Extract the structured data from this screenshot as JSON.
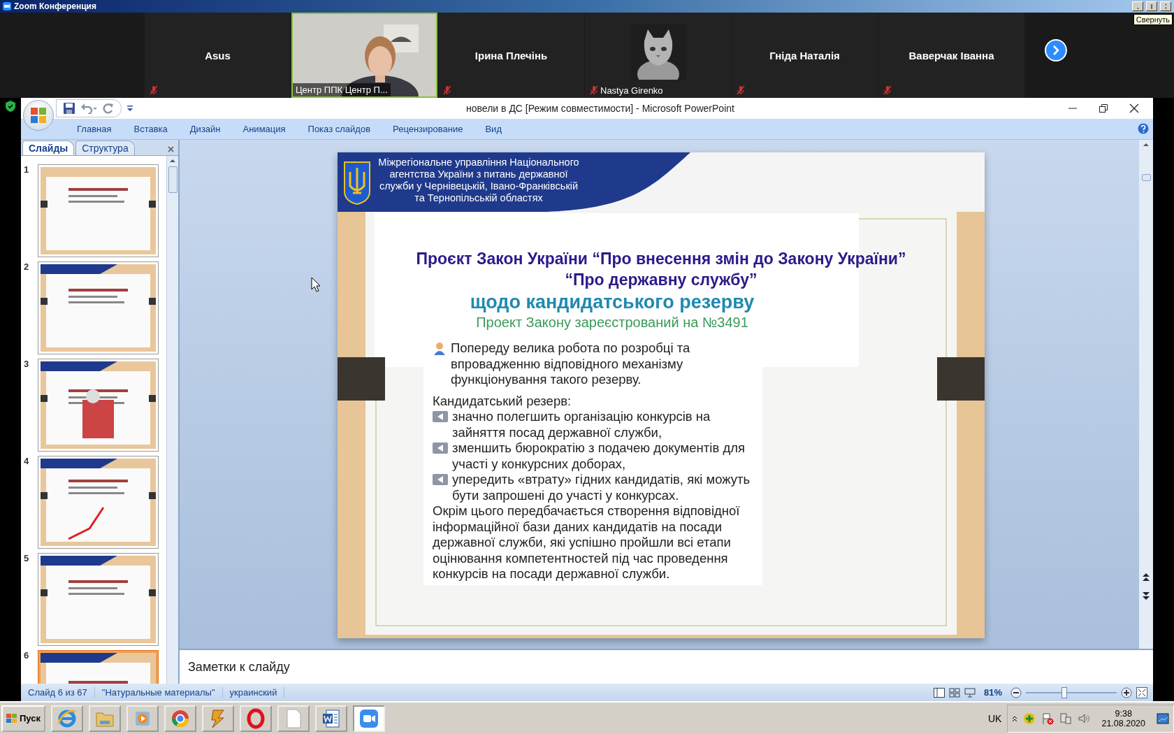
{
  "zoom_window": {
    "title": "Zoom Конференция",
    "tooltip": "Свернуть"
  },
  "participants": [
    {
      "name": "Asus",
      "kind": "name",
      "selected": false
    },
    {
      "name": "Центр ППК Центр П...",
      "kind": "video",
      "selected": true
    },
    {
      "name": "Ірина Плечінь",
      "kind": "name",
      "selected": false
    },
    {
      "name": "Nastya Girenko",
      "selected": false
    },
    {
      "name": "Гніда Наталія",
      "kind": "name",
      "selected": false
    },
    {
      "name": "Ваверчак Іванна",
      "kind": "name",
      "selected": false
    }
  ],
  "powerpoint": {
    "title": "новели в ДС [Режим совместимости] - Microsoft PowerPoint",
    "ribbon_tabs": [
      "Главная",
      "Вставка",
      "Дизайн",
      "Анимация",
      "Показ слайдов",
      "Рецензирование",
      "Вид"
    ],
    "pane_tabs": [
      {
        "label": "Слайды",
        "selected": true
      },
      {
        "label": "Структура",
        "selected": false
      }
    ],
    "thumbnails": [
      {
        "number": "1",
        "selected": false
      },
      {
        "number": "2",
        "selected": false
      },
      {
        "number": "3",
        "selected": false
      },
      {
        "number": "4",
        "selected": false
      },
      {
        "number": "5",
        "selected": false
      },
      {
        "number": "6",
        "selected": true
      }
    ],
    "slide": {
      "header_lines": [
        "Міжрегіональне управління Національного",
        "агентства України з питань державної",
        "служби  у Чернівецькій, Івано-Франківській",
        "та Тернопільській областях"
      ],
      "title_lines": [
        "Проєкт Закон України “Про внесення змін до Закону України”",
        "“Про державну службу”"
      ],
      "subtitle": "щодо  кандидатського резерву",
      "note": "Проект Закону зареєстрований на №3491",
      "body": [
        {
          "kind": "person",
          "text": "Попереду велика робота по розробці та впровадженню відповідного механізму функціонування такого резерву."
        },
        {
          "kind": "gap",
          "text": "Кандидатський резерв:"
        },
        {
          "kind": "arrow",
          "text": "значно полегшить організацію конкурсів на зайняття посад державної служби,"
        },
        {
          "kind": "arrow",
          "text": "зменшить бюрократію з подачею документів для участі у конкурсних доборах,"
        },
        {
          "kind": "arrow",
          "text": "упередить «втрату» гідних кандидатів, які можуть бути запрошені до участі у конкурсах."
        },
        {
          "kind": "plain",
          "text": "Окрім цього передбачається створення відповідної інформаційної бази даних кандидатів на посади державної служби, які успішно пройшли всі етапи оцінювання компетентностей під час проведення конкурсів на посади державної служби."
        }
      ]
    },
    "notes": "Заметки к слайду",
    "status": [
      "Слайд 6 из 67",
      "\"Натуральные материалы\"",
      "украинский"
    ],
    "zoom_percent": "81%",
    "zoom_slider": {
      "level": 0.42
    }
  },
  "taskbar": {
    "start": "Пуск",
    "apps": [
      {
        "kind": "ie",
        "selected": false
      },
      {
        "kind": "folder",
        "selected": false
      },
      {
        "kind": "media",
        "selected": false
      },
      {
        "kind": "chrome",
        "selected": false
      },
      {
        "kind": "bolt",
        "selected": false
      },
      {
        "kind": "opera",
        "selected": false
      },
      {
        "kind": "file",
        "selected": false
      },
      {
        "kind": "word",
        "selected": false
      },
      {
        "kind": "zoom",
        "selected": true
      }
    ],
    "language": "UK",
    "time": "9:38",
    "date": "21.08.2020"
  }
}
